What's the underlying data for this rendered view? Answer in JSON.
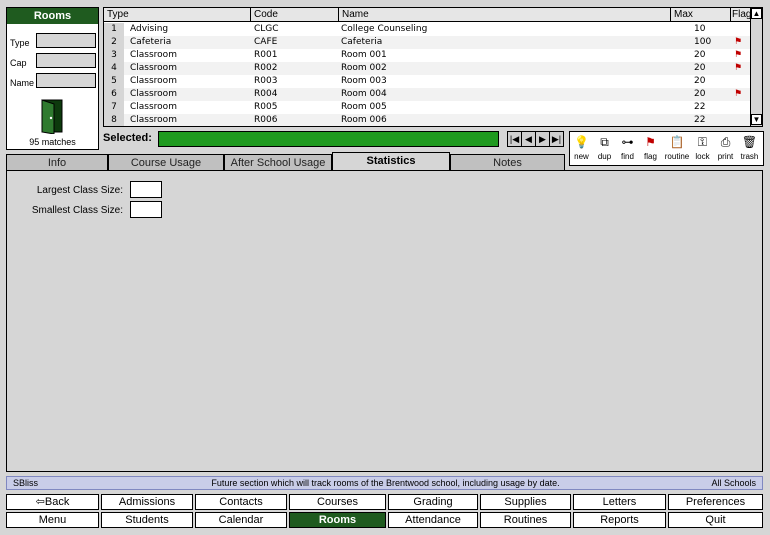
{
  "left_panel": {
    "title": "Rooms",
    "labels": {
      "type": "Type",
      "cap": "Cap",
      "name": "Name"
    },
    "matches": "95 matches"
  },
  "table": {
    "headers": {
      "type": "Type",
      "code": "Code",
      "name": "Name",
      "max": "Max",
      "flag": "Flag"
    },
    "rows": [
      {
        "num": "1",
        "type": "Advising",
        "code": "CLGC",
        "name": "College Counseling",
        "max": "10",
        "flag": false
      },
      {
        "num": "2",
        "type": "Cafeteria",
        "code": "CAFE",
        "name": "Cafeteria",
        "max": "100",
        "flag": true
      },
      {
        "num": "3",
        "type": "Classroom",
        "code": "R001",
        "name": "Room 001",
        "max": "20",
        "flag": true
      },
      {
        "num": "4",
        "type": "Classroom",
        "code": "R002",
        "name": "Room 002",
        "max": "20",
        "flag": true
      },
      {
        "num": "5",
        "type": "Classroom",
        "code": "R003",
        "name": "Room 003",
        "max": "20",
        "flag": false
      },
      {
        "num": "6",
        "type": "Classroom",
        "code": "R004",
        "name": "Room 004",
        "max": "20",
        "flag": true
      },
      {
        "num": "7",
        "type": "Classroom",
        "code": "R005",
        "name": "Room 005",
        "max": "22",
        "flag": false
      },
      {
        "num": "8",
        "type": "Classroom",
        "code": "R006",
        "name": "Room 006",
        "max": "22",
        "flag": false
      }
    ]
  },
  "selected_label": "Selected:",
  "toolbar": {
    "new": "new",
    "dup": "dup",
    "find": "find",
    "flag": "flag",
    "routine": "routine",
    "lock": "lock",
    "print": "print",
    "trash": "trash"
  },
  "tabs": {
    "info": "Info",
    "course_usage": "Course Usage",
    "after_school": "After School Usage",
    "statistics": "Statistics",
    "notes": "Notes"
  },
  "stats": {
    "largest_label": "Largest Class Size:",
    "smallest_label": "Smallest Class Size:"
  },
  "status": {
    "left": "SBliss",
    "center": "Future section which will track rooms of the Brentwood school, including usage by date.",
    "right": "All Schools"
  },
  "buttons": {
    "back": "Back",
    "admissions": "Admissions",
    "contacts": "Contacts",
    "courses": "Courses",
    "grading": "Grading",
    "supplies": "Supplies",
    "letters": "Letters",
    "preferences": "Preferences",
    "menu": "Menu",
    "students": "Students",
    "calendar": "Calendar",
    "rooms": "Rooms",
    "attendance": "Attendance",
    "routines": "Routines",
    "reports": "Reports",
    "quit": "Quit"
  },
  "colors": {
    "accent": "#1f5b1f",
    "selected_bar": "#1f9a1f",
    "flag": "#c00000",
    "status_bg": "#c9cde8"
  }
}
